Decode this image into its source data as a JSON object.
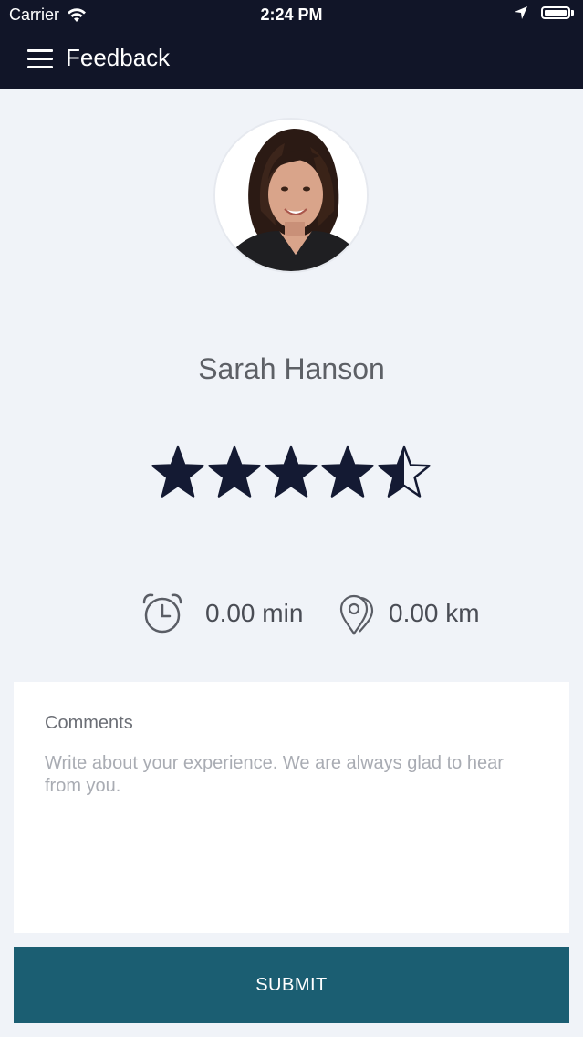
{
  "status_bar": {
    "carrier": "Carrier",
    "time": "2:24 PM",
    "battery_level": 1.0
  },
  "nav": {
    "title": "Feedback",
    "menu_icon": "hamburger-menu-icon"
  },
  "driver": {
    "name": "Sarah Hanson",
    "rating": 4.5,
    "rating_max": 5
  },
  "stats": {
    "time_value": "0.00 min",
    "time_icon": "alarm-clock-icon",
    "distance_value": "0.00 km",
    "distance_icon": "map-pin-icon"
  },
  "comments": {
    "label": "Comments",
    "value": "",
    "placeholder": "Write about your experience. We are always glad to hear from you."
  },
  "submit": {
    "label": "SUBMIT"
  },
  "colors": {
    "header_bg": "#111528",
    "page_bg": "#f0f3f8",
    "star": "#141a33",
    "submit_bg": "#1b5e72"
  }
}
